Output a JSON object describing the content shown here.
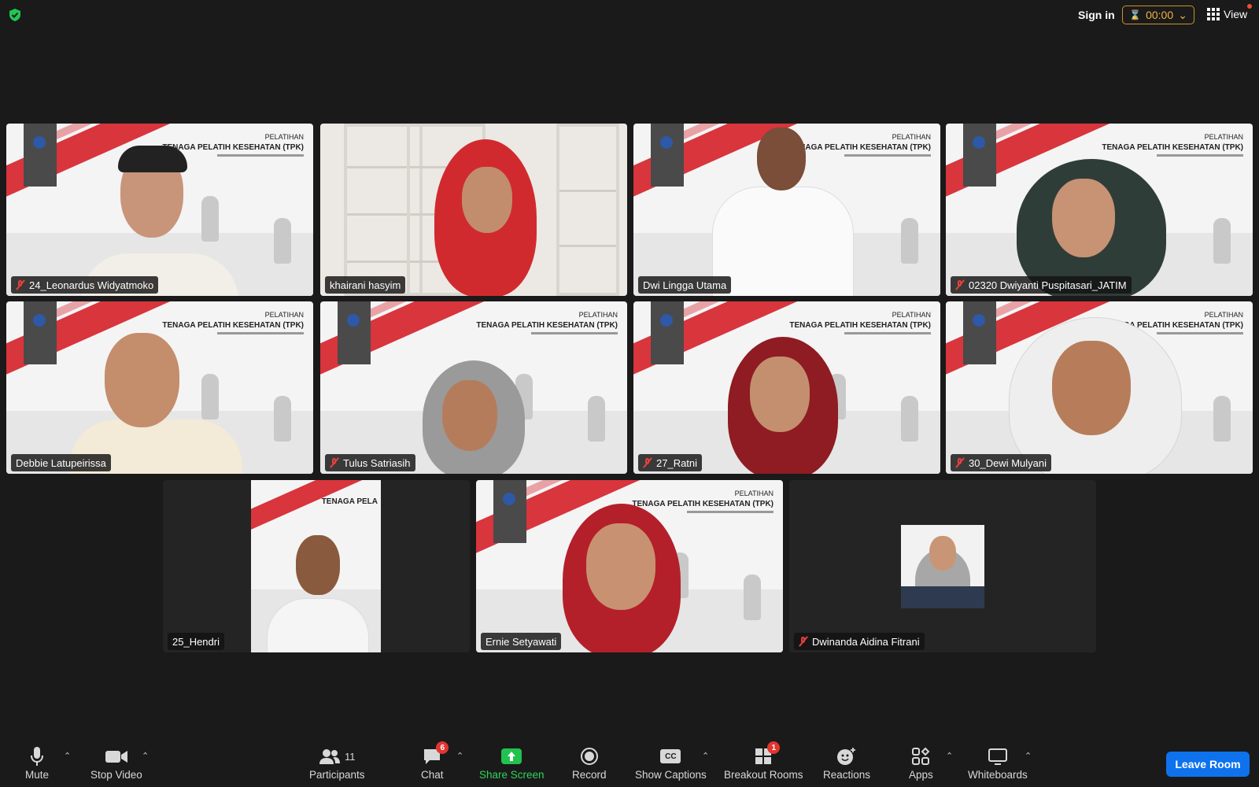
{
  "topbar": {
    "sign_in": "Sign in",
    "timer": "00:00",
    "view_label": "View"
  },
  "slide": {
    "line1": "PELATIHAN",
    "line2": "TENAGA PELATIH KESEHATAN (TPK)",
    "line2_cropped": "TENAGA PELA"
  },
  "participants_tiles": [
    {
      "name": "24_Leonardus Widyatmoko",
      "muted": true
    },
    {
      "name": "khairani hasyim",
      "muted": false,
      "active_speaker": true
    },
    {
      "name": "Dwi Lingga Utama",
      "muted": false
    },
    {
      "name": "02320 Dwiyanti Puspitasari_JATIM",
      "muted": true
    },
    {
      "name": "Debbie Latupeirissa",
      "muted": false
    },
    {
      "name": "Tulus Satriasih",
      "muted": true
    },
    {
      "name": "27_Ratni",
      "muted": true
    },
    {
      "name": "30_Dewi Mulyani",
      "muted": true
    },
    {
      "name": "25_Hendri",
      "muted": false
    },
    {
      "name": "Ernie Setyawati",
      "muted": false
    },
    {
      "name": "Dwinanda Aidina Fitrani",
      "muted": true
    }
  ],
  "toolbar": {
    "mute": "Mute",
    "stop_video": "Stop Video",
    "participants": "Participants",
    "participants_count": "11",
    "chat": "Chat",
    "chat_badge": "6",
    "share_screen": "Share Screen",
    "record": "Record",
    "show_captions": "Show Captions",
    "captions_icon_text": "CC",
    "breakout_rooms": "Breakout Rooms",
    "breakout_badge": "1",
    "reactions": "Reactions",
    "apps": "Apps",
    "whiteboards": "Whiteboards",
    "leave_room": "Leave Room"
  },
  "colors": {
    "background": "#1a1a1a",
    "active_speaker_border": "#23c552",
    "leave_button": "#0e72ed",
    "share_screen": "#22c24f",
    "muted_icon": "#e8413c",
    "timer": "#f0b43c"
  }
}
